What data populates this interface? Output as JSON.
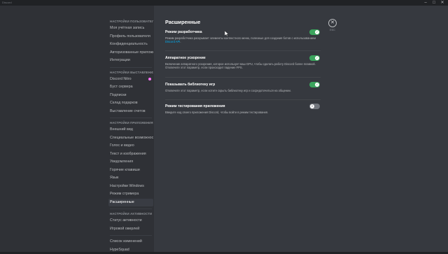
{
  "titlebar": {
    "app_title": "Discord",
    "minimize_glyph": "–",
    "maximize_glyph": "□",
    "close_glyph": "✕"
  },
  "sidebar": {
    "sections": [
      {
        "header": "НАСТРОЙКИ ПОЛЬЗОВАТЕЛЯ",
        "items": [
          {
            "label": "Моя учётная запись"
          },
          {
            "label": "Профиль пользователя"
          },
          {
            "label": "Конфиденциальность"
          },
          {
            "label": "Авторизованные приложения"
          },
          {
            "label": "Интеграции"
          }
        ]
      },
      {
        "header": "НАСТРОЙКИ ВЫСТАВЛЕНИЯ СЧЕТОВ",
        "items": [
          {
            "label": "Discord Nitro"
          },
          {
            "label": "Буст сервера"
          },
          {
            "label": "Подписки"
          },
          {
            "label": "Склад подарков"
          },
          {
            "label": "Выставление счетов"
          }
        ]
      },
      {
        "header": "НАСТРОЙКИ ПРИЛОЖЕНИЯ",
        "items": [
          {
            "label": "Внешний вид"
          },
          {
            "label": "Специальные возможности"
          },
          {
            "label": "Голос и видео"
          },
          {
            "label": "Текст и изображения"
          },
          {
            "label": "Уведомления"
          },
          {
            "label": "Горячие клавиши"
          },
          {
            "label": "Язык"
          },
          {
            "label": "Настройки Windows"
          },
          {
            "label": "Режим стримера"
          },
          {
            "label": "Расширенные"
          }
        ]
      },
      {
        "header": "НАСТРОЙКИ АКТИВНОСТИ",
        "items": [
          {
            "label": "Статус активности"
          },
          {
            "label": "Игровой оверлей"
          }
        ]
      },
      {
        "header": "",
        "items": [
          {
            "label": "Список изменений"
          },
          {
            "label": "HypeSquad"
          }
        ]
      }
    ],
    "active_item": "Расширенные",
    "nitro_badge_color": "#ff73fa"
  },
  "main": {
    "title": "Расширенные",
    "close_label": "ESC",
    "close_glyph": "✕",
    "settings": [
      {
        "title": "Режим разработчика",
        "desc": "Режим разработчика раскрывает элементы контекстного меню, полезные для создания ботов с использованием",
        "link": "Discord API",
        "desc_after": ".",
        "enabled": true
      },
      {
        "title": "Аппаратное ускорение",
        "desc": "Включение аппаратного ускорения, которое использует ваш GPU, чтобы сделать работу Discord более плавной. Отключите этот параметр, если происходит падение FPS.",
        "enabled": true
      },
      {
        "title": "Показывать библиотеку игр",
        "desc": "Отключите этот параметр, если хотите скрыть библиотеку игр и сосредоточиться на общении.",
        "enabled": true
      },
      {
        "title": "Режим тестирования приложения",
        "desc": "Введите код своего приложения Discord, чтобы войти в режим тестирования.",
        "enabled": false
      }
    ]
  },
  "colors": {
    "toggle_on": "#3ba55d",
    "toggle_off": "#72767d",
    "link": "#00b0f4",
    "background": "#36393f",
    "sidebar": "#2f3136"
  }
}
